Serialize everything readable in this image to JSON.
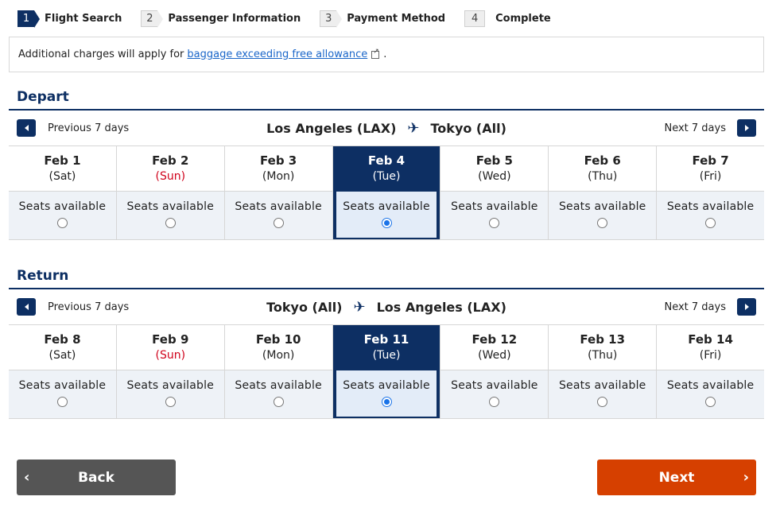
{
  "steps": [
    {
      "num": "1",
      "label": "Flight Search",
      "active": true
    },
    {
      "num": "2",
      "label": "Passenger Information",
      "active": false
    },
    {
      "num": "3",
      "label": "Payment Method",
      "active": false
    },
    {
      "num": "4",
      "label": "Complete",
      "active": false
    }
  ],
  "notice": {
    "prefix": "Additional charges will apply for",
    "link": "baggage exceeding free allowance",
    "suffix": "."
  },
  "depart": {
    "title": "Depart",
    "prev_label": "Previous 7 days",
    "next_label": "Next 7 days",
    "origin": "Los Angeles (LAX)",
    "destination": "Tokyo (All)",
    "selected_index": 3,
    "days": [
      {
        "date": "Feb 1",
        "weekday": "(Sat)",
        "status": "Seats available",
        "sunday": false
      },
      {
        "date": "Feb 2",
        "weekday": "(Sun)",
        "status": "Seats available",
        "sunday": true
      },
      {
        "date": "Feb 3",
        "weekday": "(Mon)",
        "status": "Seats available",
        "sunday": false
      },
      {
        "date": "Feb 4",
        "weekday": "(Tue)",
        "status": "Seats available",
        "sunday": false
      },
      {
        "date": "Feb 5",
        "weekday": "(Wed)",
        "status": "Seats available",
        "sunday": false
      },
      {
        "date": "Feb 6",
        "weekday": "(Thu)",
        "status": "Seats available",
        "sunday": false
      },
      {
        "date": "Feb 7",
        "weekday": "(Fri)",
        "status": "Seats available",
        "sunday": false
      }
    ]
  },
  "return": {
    "title": "Return",
    "prev_label": "Previous 7 days",
    "next_label": "Next 7 days",
    "origin": "Tokyo (All)",
    "destination": "Los Angeles (LAX)",
    "selected_index": 3,
    "days": [
      {
        "date": "Feb 8",
        "weekday": "(Sat)",
        "status": "Seats available",
        "sunday": false
      },
      {
        "date": "Feb 9",
        "weekday": "(Sun)",
        "status": "Seats available",
        "sunday": true
      },
      {
        "date": "Feb 10",
        "weekday": "(Mon)",
        "status": "Seats available",
        "sunday": false
      },
      {
        "date": "Feb 11",
        "weekday": "(Tue)",
        "status": "Seats available",
        "sunday": false
      },
      {
        "date": "Feb 12",
        "weekday": "(Wed)",
        "status": "Seats available",
        "sunday": false
      },
      {
        "date": "Feb 13",
        "weekday": "(Thu)",
        "status": "Seats available",
        "sunday": false
      },
      {
        "date": "Feb 14",
        "weekday": "(Fri)",
        "status": "Seats available",
        "sunday": false
      }
    ]
  },
  "buttons": {
    "back": "Back",
    "next": "Next"
  },
  "icons": {
    "plane": "✈",
    "chevron_left": "‹",
    "chevron_right": "›"
  },
  "colors": {
    "brand_navy": "#0d2f63",
    "next_orange": "#d64000",
    "back_gray": "#555555",
    "sunday_red": "#d0021b",
    "link_blue": "#1a66c9"
  }
}
